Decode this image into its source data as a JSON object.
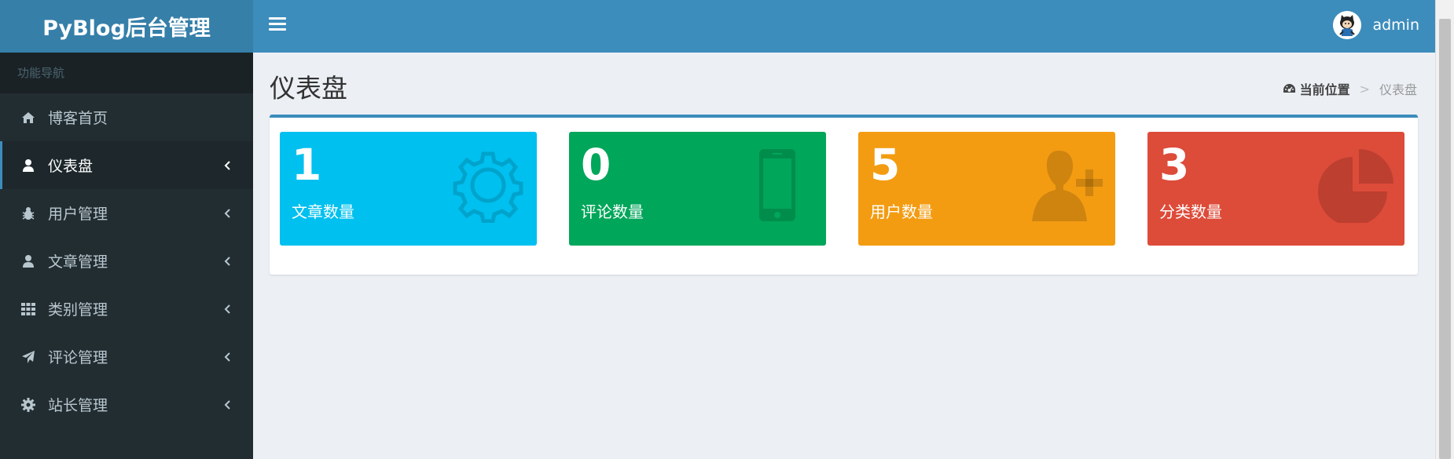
{
  "header": {
    "logo": "PyBlog后台管理",
    "user_name": "admin"
  },
  "sidebar": {
    "header": "功能导航",
    "items": [
      {
        "label": "博客首页",
        "icon": "home-icon"
      },
      {
        "label": "仪表盘",
        "icon": "user-icon",
        "active": true
      },
      {
        "label": "用户管理",
        "icon": "bug-icon"
      },
      {
        "label": "文章管理",
        "icon": "user-icon"
      },
      {
        "label": "类别管理",
        "icon": "grid-icon"
      },
      {
        "label": "评论管理",
        "icon": "paper-plane-icon"
      },
      {
        "label": "站长管理",
        "icon": "gear-icon"
      }
    ]
  },
  "main": {
    "title": "仪表盘",
    "breadcrumb": {
      "home": "当前位置",
      "separator": ">",
      "current": "仪表盘"
    },
    "stats": [
      {
        "value": "1",
        "label": "文章数量",
        "color": "#00c0ef",
        "icon": "gear-icon"
      },
      {
        "value": "0",
        "label": "评论数量",
        "color": "#00a65a",
        "icon": "mobile-icon"
      },
      {
        "value": "5",
        "label": "用户数量",
        "color": "#f39c12",
        "icon": "user-plus-icon"
      },
      {
        "value": "3",
        "label": "分类数量",
        "color": "#dd4b39",
        "icon": "pie-chart-icon"
      }
    ]
  },
  "colors": {
    "header": "#3c8dbc",
    "logo": "#367fa9",
    "sidebar": "#222d32"
  }
}
